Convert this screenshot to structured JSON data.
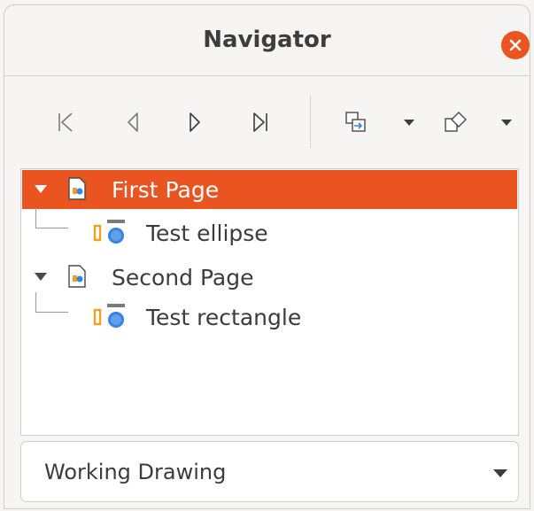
{
  "window": {
    "title": "Navigator",
    "close_icon": "close-icon",
    "accent_color": "#e95420"
  },
  "toolbar": {
    "buttons": [
      {
        "name": "first-item-button",
        "icon": "skip-first-icon"
      },
      {
        "name": "previous-item-button",
        "icon": "previous-icon"
      },
      {
        "name": "next-item-button",
        "icon": "next-icon"
      },
      {
        "name": "last-item-button",
        "icon": "skip-last-icon"
      },
      {
        "name": "drag-mode-button",
        "icon": "drag-mode-icon",
        "has_dropdown": true
      },
      {
        "name": "shapes-button",
        "icon": "shapes-icon",
        "has_dropdown": true
      }
    ]
  },
  "tree": {
    "items": [
      {
        "label": "First Page",
        "type": "page",
        "expanded": true,
        "selected": true
      },
      {
        "label": "Test ellipse",
        "type": "shape",
        "level": 1
      },
      {
        "label": "Second Page",
        "type": "page",
        "expanded": true,
        "selected": false
      },
      {
        "label": "Test rectangle",
        "type": "shape",
        "level": 1
      }
    ]
  },
  "document_select": {
    "value": "Working Drawing"
  }
}
